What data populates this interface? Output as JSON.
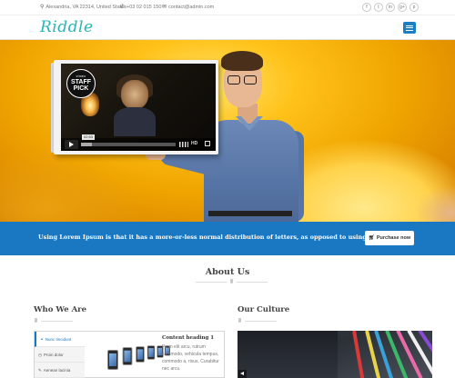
{
  "topbar": {
    "address": "Alexandria, VA 22314, United States",
    "phone": "+03 02 015 150",
    "email": "contact@admin.com",
    "socials": [
      "facebook-icon",
      "twitter-icon",
      "linkedin-icon",
      "google-plus-icon",
      "pinterest-icon"
    ],
    "social_glyphs": [
      "f",
      "t",
      "in",
      "g+",
      "p"
    ]
  },
  "header": {
    "logo": "Riddle",
    "menu_icon": "hamburger-icon"
  },
  "hero": {
    "video": {
      "badge_top": "vimeo",
      "badge_main": "STAFF PICK",
      "timecode": "02:53",
      "progress_fraction": 0.12,
      "quality": "HD"
    }
  },
  "band": {
    "text": "Using Lorem Ipsum is that it has a more-or-less normal distribution of letters, as opposed to using.",
    "button_label": "Purchase now",
    "button_icon": "cart-icon"
  },
  "about": {
    "title": "About Us"
  },
  "who": {
    "title": "Who We Are",
    "tabs": [
      {
        "label": "Nunc tincidunt",
        "icon": "link-icon",
        "glyph": "⚭"
      },
      {
        "label": "Proin dolor",
        "icon": "clock-icon",
        "glyph": "◷"
      },
      {
        "label": "Aenean lacinia",
        "icon": "pencil-icon",
        "glyph": "✎"
      }
    ],
    "content_heading": "Content heading 1",
    "content_text": "Proin elit arcu, rutrum commodo, vehicula tempus, commodo a, risus. Curabitur nec arcu."
  },
  "culture": {
    "title": "Our Culture"
  },
  "colors": {
    "accent": "#1a78c2",
    "logo": "#2ab3b3"
  }
}
